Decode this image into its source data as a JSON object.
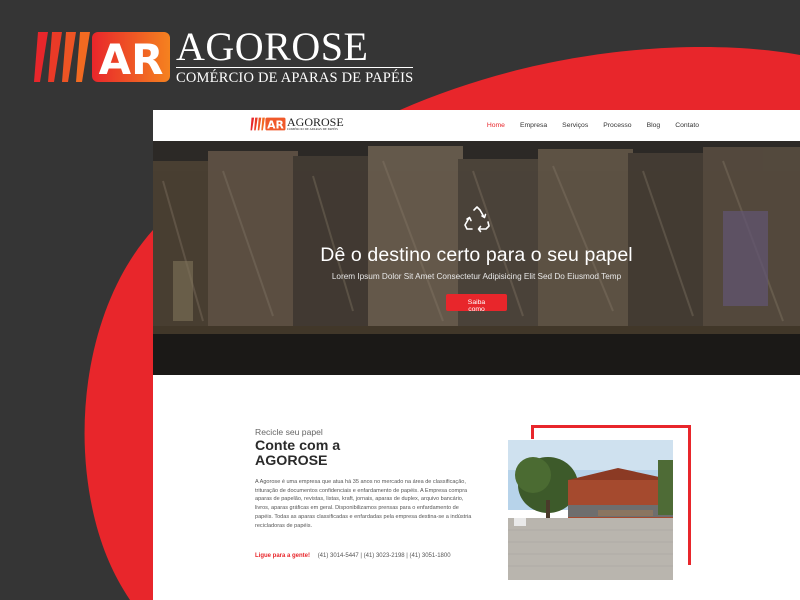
{
  "brand": {
    "name": "AGOROSE",
    "tagline": "COMÉRCIO DE APARAS DE PAPÉIS",
    "mark_letters": "AR"
  },
  "nav": {
    "items": [
      "Home",
      "Empresa",
      "Serviços",
      "Processo",
      "Blog",
      "Contato"
    ],
    "active": "Home"
  },
  "hero": {
    "icon": "recycle-icon",
    "title": "Dê o destino certo para o seu papel",
    "subtitle": "Lorem Ipsum Dolor Sit Amet Consectetur Adipisicing Elit Sed Do Eiusmod Temp",
    "button_label": "Saiba como"
  },
  "about": {
    "eyebrow": "Recicle seu papel",
    "title": "Conte com a AGOROSE",
    "text": "A Agorose é uma empresa que atua há 35 anos no mercado na área de classificação, trituração de documentos confidenciais e enfardamento de papéis. A Empresa compra aparas de papelão, revistas, listas, kraft, jornais, aparas de duplex, arquivo bancário, livros, aparas gráficas em geral. Disponibilizamos prensas para o enfardamento de papéis. Todas as aparas classificadas e enfardadas pela empresa destina-se a indústria recicladoras de papéis.",
    "cta": "Ligue para a gente!",
    "phones": "(41) 3014-5447 | (41) 3023-2198 | (41) 3051-1800"
  },
  "colors": {
    "accent": "#e8262b",
    "background": "#353535",
    "orange": "#f5821f"
  }
}
